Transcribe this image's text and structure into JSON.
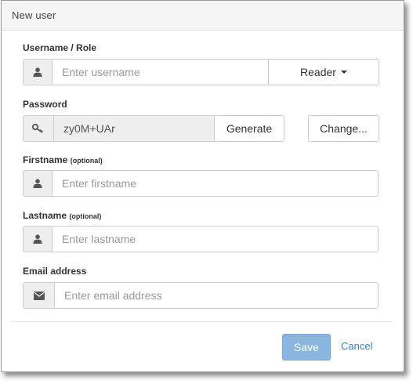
{
  "dialog": {
    "title": "New user"
  },
  "username": {
    "label": "Username / Role",
    "placeholder": "Enter username",
    "icon": "user-icon",
    "role_value": "Reader"
  },
  "password": {
    "label": "Password",
    "icon": "key-icon",
    "value": "zy0M+UAr",
    "generate_label": "Generate",
    "change_label": "Change..."
  },
  "firstname": {
    "label": "Firstname",
    "optional": "(optional)",
    "placeholder": "Enter firstname",
    "icon": "user-icon"
  },
  "lastname": {
    "label": "Lastname",
    "optional": "(optional)",
    "placeholder": "Enter lastname",
    "icon": "user-icon"
  },
  "email": {
    "label": "Email address",
    "placeholder": "Enter email address",
    "icon": "envelope-icon"
  },
  "footer": {
    "save_label": "Save",
    "cancel_label": "Cancel"
  },
  "colors": {
    "primary_disabled": "#8ab5de",
    "link": "#3a7fc1",
    "addon_bg": "#eeeeee"
  }
}
